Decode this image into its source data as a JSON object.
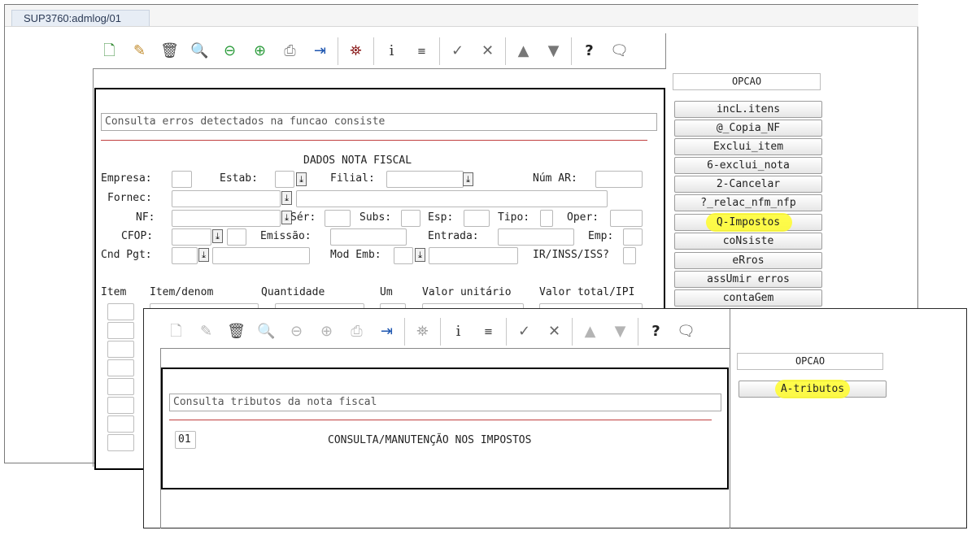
{
  "tab": {
    "title": "SUP3760:admlog/01"
  },
  "main": {
    "opcao_label": "OPCAO",
    "consult_text": "Consulta erros detectados na funcao consiste",
    "section_title": "DADOS NOTA FISCAL",
    "labels": {
      "empresa": "Empresa:",
      "estab": "Estab:",
      "filial": "Filial:",
      "num_ar": "Núm AR:",
      "fornec": "Fornec:",
      "nf": "NF:",
      "ser": "Sér:",
      "subs": "Subs:",
      "esp": "Esp:",
      "tipo": "Tipo:",
      "oper": "Oper:",
      "cfop": "CFOP:",
      "emissao": "Emissão:",
      "entrada": "Entrada:",
      "emp": "Emp:",
      "cnd_pgt": "Cnd Pgt:",
      "mod_emb": "Mod Emb:",
      "ir_inss": "IR/INSS/ISS?"
    },
    "grid_headers": [
      "Item",
      "Item/denom",
      "Quantidade",
      "Um",
      "Valor unitário",
      "Valor total/IPI"
    ],
    "options": [
      "incL.itens",
      "@_Copia_NF",
      "Exclui_item",
      "6-exclui_nota",
      "2-Cancelar",
      "?_relac_nfm_nfp",
      "Q-Impostos",
      "coNsiste",
      "eRros",
      "assUmir erros",
      "contaGem"
    ],
    "highlighted_option": "Q-Impostos"
  },
  "popup": {
    "opcao_label": "OPCAO",
    "consult_text": "Consulta tributos da nota fiscal",
    "options": [
      "A-tributos"
    ],
    "highlighted_option": "A-tributos",
    "row": {
      "code": "01",
      "description": "CONSULTA/MANUTENÇÃO NOS IMPOSTOS"
    }
  },
  "toolbar_icons": [
    "new-document-icon",
    "edit-icon",
    "trash-icon",
    "search-icon",
    "previous-icon",
    "next-icon",
    "print-icon",
    "exit-door-icon",
    "binoculars-icon",
    "info-icon",
    "list-icon",
    "check-icon",
    "tools-icon",
    "first-icon",
    "last-icon",
    "help-icon",
    "comment-icon"
  ],
  "colors": {
    "highlight": "#fffb2a",
    "separator_line": "#c04040",
    "tab_bg": "#e7edf5"
  }
}
